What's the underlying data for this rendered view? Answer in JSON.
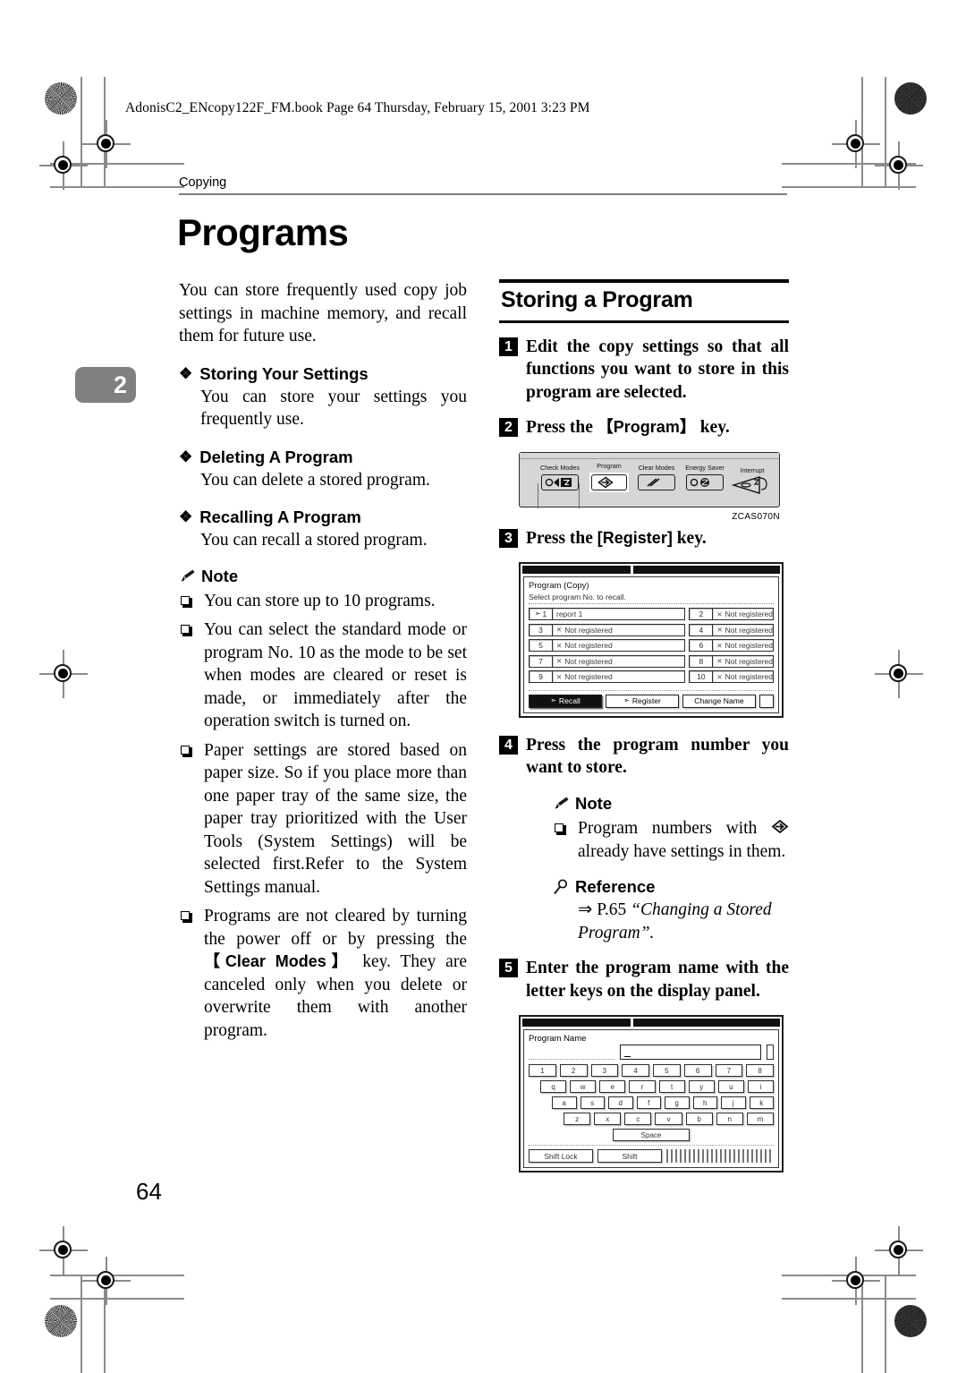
{
  "book_header": "AdonisC2_ENcopy122F_FM.book  Page 64  Thursday, February 15, 2001  3:23 PM",
  "running_head": "Copying",
  "chapter_tab": "2",
  "page_number": "64",
  "title": "Programs",
  "intro": "You can store frequently used copy job settings in machine memory, and recall them for future use.",
  "subsections": [
    {
      "bullet": "❖",
      "heading": "Storing Your Settings",
      "body": "You can store your settings you frequently use."
    },
    {
      "bullet": "❖",
      "heading": "Deleting A Program",
      "body": "You can delete a stored program."
    },
    {
      "bullet": "❖",
      "heading": "Recalling A Program",
      "body": "You can recall a stored program."
    }
  ],
  "note_label": "Note",
  "reference_label": "Reference",
  "note_icon": "pencil-icon",
  "reference_icon": "magnifier-icon",
  "left_notes": [
    "You can store up to 10 programs.",
    "You can select the standard mode or program No. 10 as the mode to be set when modes are cleared or reset is made, or immediately after the operation switch is turned on.",
    "Paper settings are stored based on paper size. So if you place more than one paper tray of the same size, the paper tray prioritized with the User Tools (System Settings) will be selected first.Refer to the System Settings manual."
  ],
  "left_note_clear": {
    "before": "Programs are not cleared by turning the power off or by pressing the ",
    "key": "【Clear Modes】",
    "after": " key. They are canceled only when you delete or overwrite them with another program."
  },
  "section": {
    "heading": "Storing a Program",
    "steps": [
      {
        "num": "1",
        "text": "Edit the copy settings so that all functions you want to store in this program are selected."
      },
      {
        "num": "2",
        "text_before": "Press the ",
        "key": "【Program】",
        "text_after": " key."
      },
      {
        "num": "3",
        "text_before": "Press the ",
        "key": "[Register]",
        "text_after": " key."
      },
      {
        "num": "4",
        "text": "Press the program number you want to store."
      },
      {
        "num": "5",
        "text": "Enter the program name with the letter keys on the display panel."
      }
    ]
  },
  "right_note": {
    "before": "Program numbers with ",
    "icon": "program-diamond-arrow-icon",
    "after": " already have settings in them."
  },
  "right_reference": {
    "arrow": "⇒",
    "page": "P.65",
    "title": "“Changing a Stored Program”."
  },
  "control_panel": {
    "caption": "ZCAS070N",
    "keys": [
      {
        "label": "Check Modes",
        "icon": "check-modes-icon",
        "highlight": false
      },
      {
        "label": "Program",
        "icon": "program-diamond-arrow-icon",
        "highlight": true
      },
      {
        "label": "Clear Modes",
        "icon": "clear-modes-slash-icon",
        "highlight": false
      },
      {
        "label": "Energy Saver",
        "icon": "energy-saver-icon",
        "highlight": false
      },
      {
        "label": "Interrupt",
        "icon": "interrupt-icon",
        "highlight": false
      }
    ]
  },
  "program_screen": {
    "title": "Program (Copy)",
    "subtitle": "Select program No. to recall.",
    "not_registered": "Not registered",
    "x_mark": "✕",
    "left_rows": [
      {
        "index": "1",
        "name": "report  1",
        "registered": true
      },
      {
        "index": "3",
        "name": "Not registered",
        "registered": false
      },
      {
        "index": "5",
        "name": "Not registered",
        "registered": false
      },
      {
        "index": "7",
        "name": "Not registered",
        "registered": false
      },
      {
        "index": "9",
        "name": "Not registered",
        "registered": false
      }
    ],
    "right_rows": [
      {
        "index": "2",
        "name": "Not registered",
        "registered": false
      },
      {
        "index": "4",
        "name": "Not registered",
        "registered": false
      },
      {
        "index": "6",
        "name": "Not registered",
        "registered": false
      },
      {
        "index": "8",
        "name": "Not registered",
        "registered": false
      },
      {
        "index": "10",
        "name": "Not registered",
        "registered": false
      }
    ],
    "buttons": [
      {
        "label": "Recall",
        "selected": true,
        "icon": "recall-arrow-icon"
      },
      {
        "label": "Register",
        "selected": false,
        "icon": "register-arrow-icon"
      },
      {
        "label": "Change Name",
        "selected": false,
        "icon": ""
      }
    ]
  },
  "keyboard_screen": {
    "title": "Program Name",
    "input_value": "",
    "rows": [
      [
        "1",
        "2",
        "3",
        "4",
        "5",
        "6",
        "7",
        "8"
      ],
      [
        "q",
        "w",
        "e",
        "r",
        "t",
        "y",
        "u",
        "i"
      ],
      [
        "a",
        "s",
        "d",
        "f",
        "g",
        "h",
        "j",
        "k"
      ],
      [
        "z",
        "x",
        "c",
        "v",
        "b",
        "n",
        "m"
      ]
    ],
    "space_label": "Space",
    "shift_lock_label": "Shift Lock",
    "shift_label": "Shift"
  }
}
